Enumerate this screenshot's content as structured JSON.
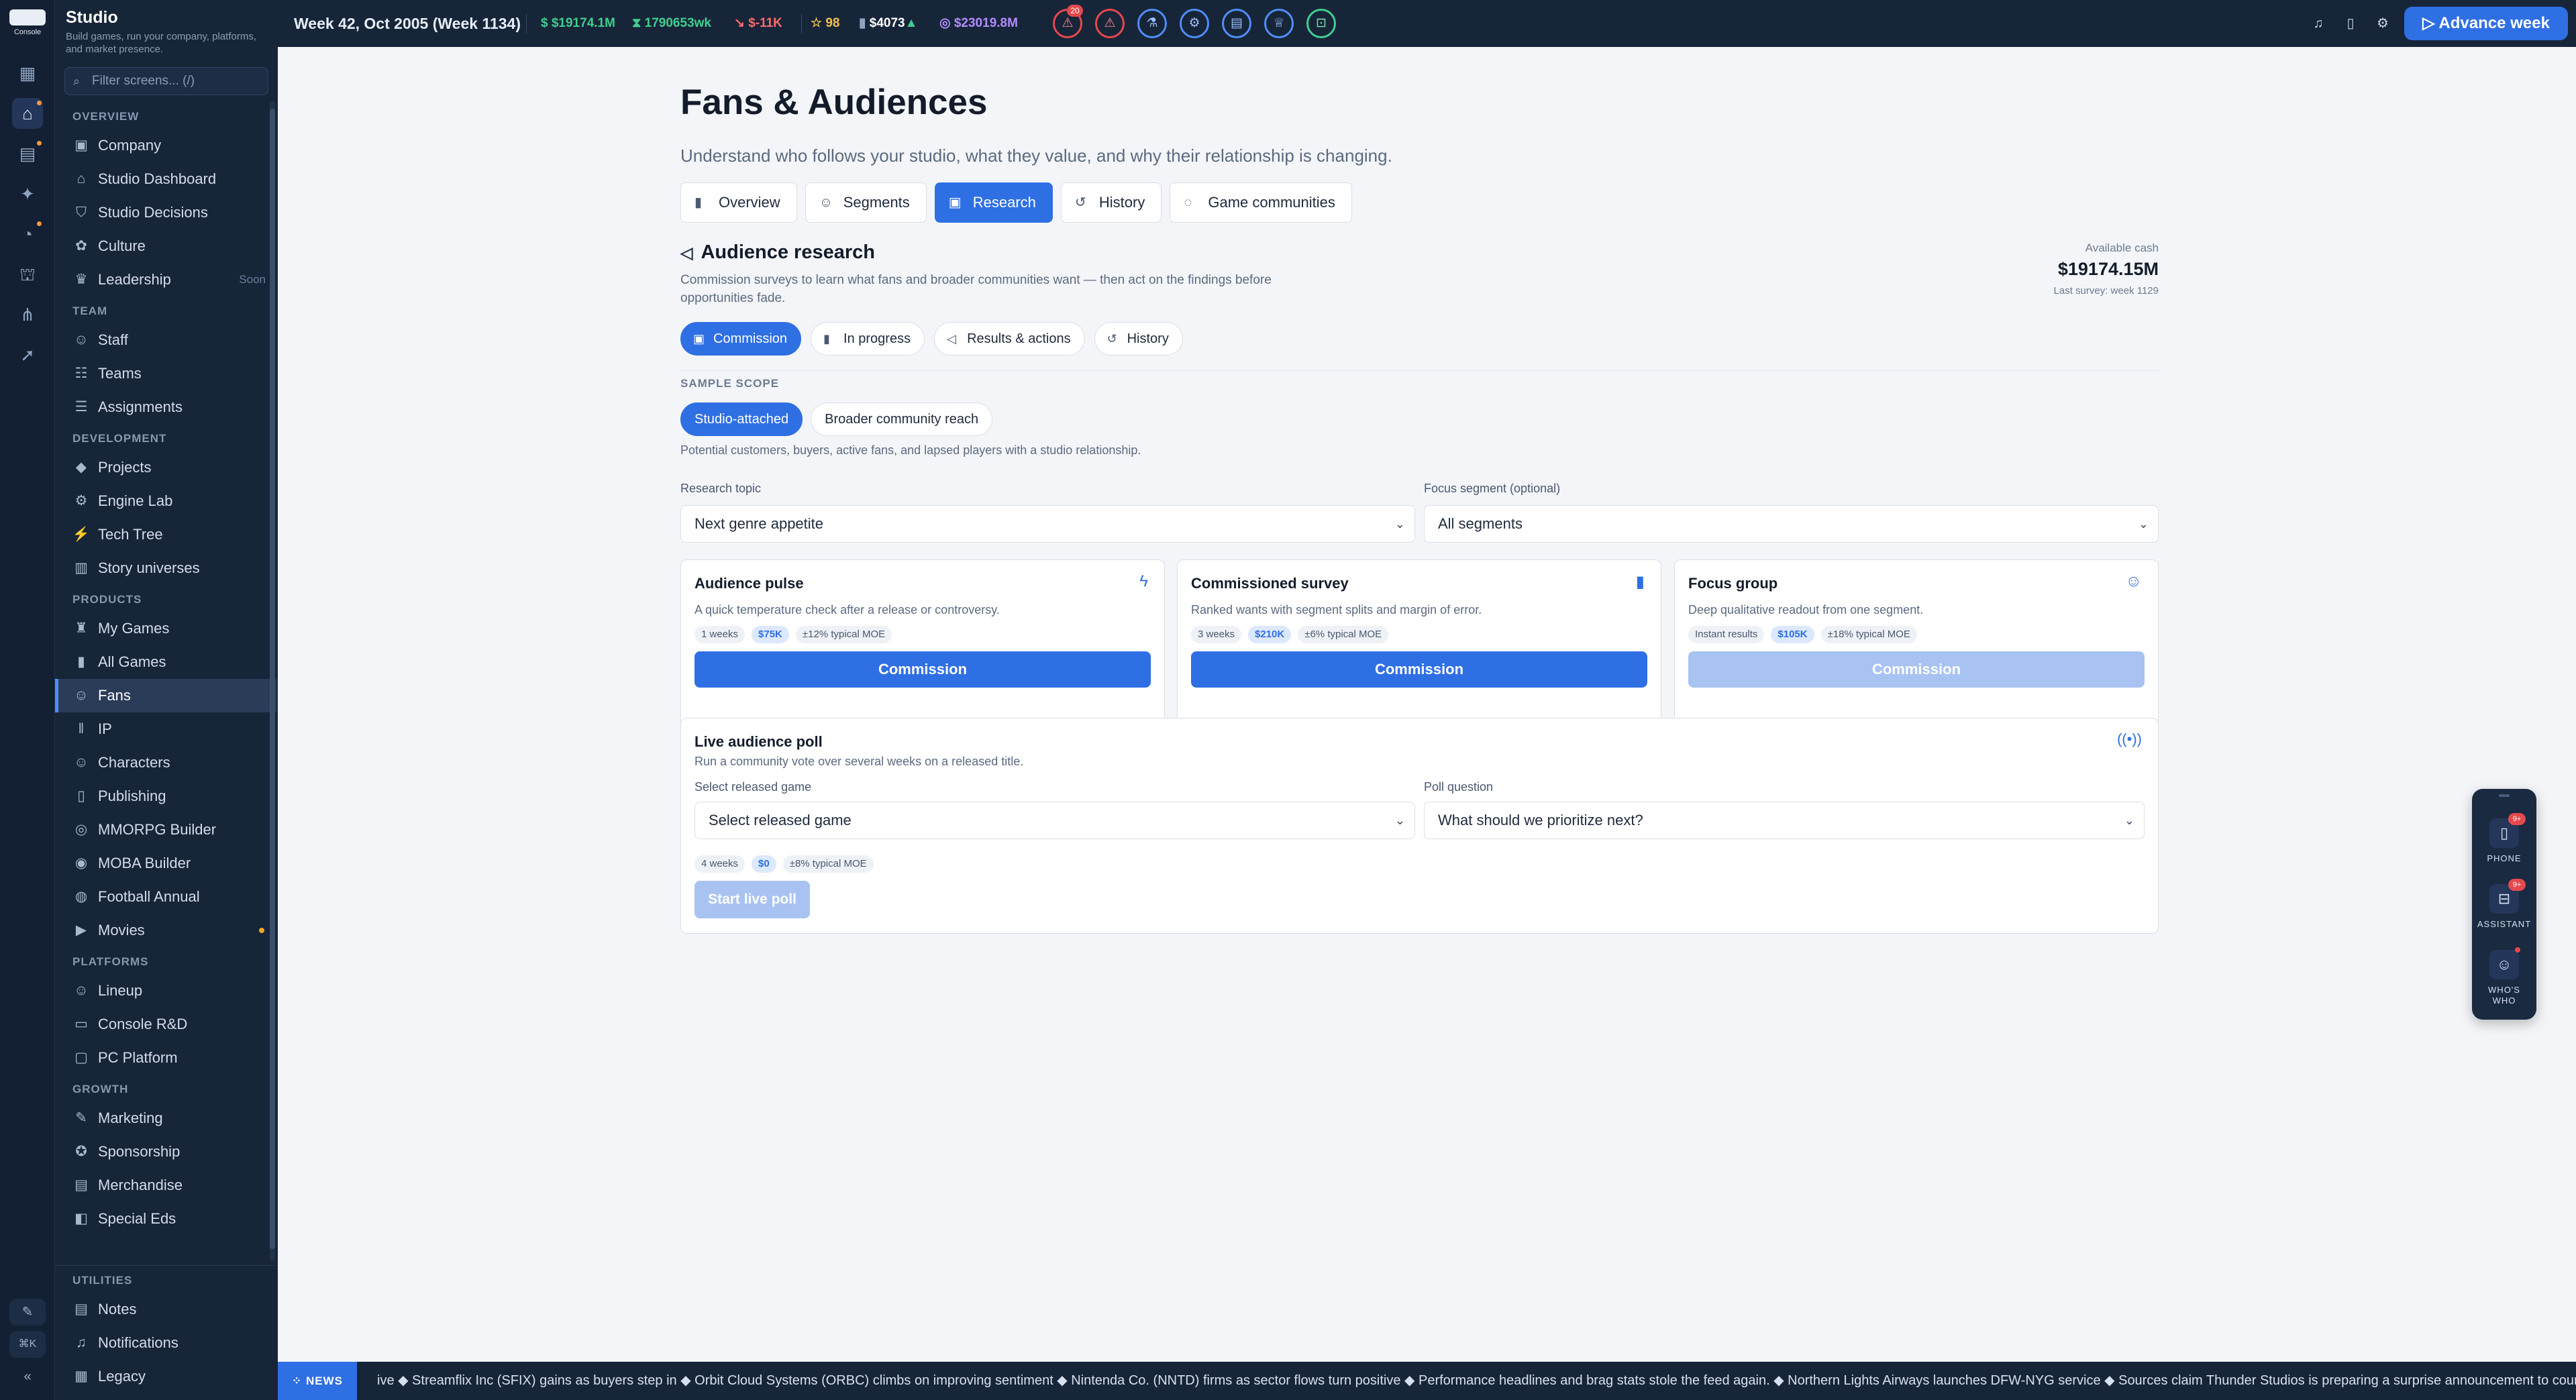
{
  "rail": {
    "logo_text": "Console",
    "items": [
      {
        "icon": "grid-icon",
        "glyph": "▦"
      },
      {
        "icon": "studio-icon",
        "glyph": "⌂"
      },
      {
        "icon": "news-icon",
        "glyph": "▤"
      },
      {
        "icon": "sparkle-icon",
        "glyph": "✦"
      },
      {
        "icon": "gauge-icon",
        "glyph": "◔"
      },
      {
        "icon": "bank-icon",
        "glyph": "⛫"
      },
      {
        "icon": "share-icon",
        "glyph": "⋔"
      },
      {
        "icon": "rocket-icon",
        "glyph": "➚"
      }
    ],
    "shortcut": "⌘K"
  },
  "sidebar": {
    "title": "Studio",
    "subtitle": "Build games, run your company, platforms, and market presence.",
    "filter_placeholder": "Filter screens... (/)",
    "sections": [
      {
        "label": "OVERVIEW",
        "items": [
          {
            "label": "Company",
            "glyph": "▣"
          },
          {
            "label": "Studio Dashboard",
            "glyph": "⌂"
          },
          {
            "label": "Studio Decisions",
            "glyph": "⛉"
          },
          {
            "label": "Culture",
            "glyph": "✿"
          },
          {
            "label": "Leadership",
            "glyph": "♛",
            "note": "Soon"
          }
        ]
      },
      {
        "label": "TEAM",
        "items": [
          {
            "label": "Staff",
            "glyph": "☺"
          },
          {
            "label": "Teams",
            "glyph": "☷"
          },
          {
            "label": "Assignments",
            "glyph": "☰"
          }
        ]
      },
      {
        "label": "DEVELOPMENT",
        "items": [
          {
            "label": "Projects",
            "glyph": "◆"
          },
          {
            "label": "Engine Lab",
            "glyph": "⚙"
          },
          {
            "label": "Tech Tree",
            "glyph": "⚡"
          },
          {
            "label": "Story universes",
            "glyph": "▥"
          }
        ]
      },
      {
        "label": "PRODUCTS",
        "items": [
          {
            "label": "My Games",
            "glyph": "♜"
          },
          {
            "label": "All Games",
            "glyph": "▮"
          },
          {
            "label": "Fans",
            "glyph": "☺",
            "active": true
          },
          {
            "label": "IP",
            "glyph": "‖"
          },
          {
            "label": "Characters",
            "glyph": "☺"
          },
          {
            "label": "Publishing",
            "glyph": "▯"
          },
          {
            "label": "MMORPG Builder",
            "glyph": "◎"
          },
          {
            "label": "MOBA Builder",
            "glyph": "◉"
          },
          {
            "label": "Football Annual",
            "glyph": "◍"
          },
          {
            "label": "Movies",
            "glyph": "▶",
            "dot": true
          }
        ]
      },
      {
        "label": "PLATFORMS",
        "items": [
          {
            "label": "Lineup",
            "glyph": "☺"
          },
          {
            "label": "Console R&D",
            "glyph": "▭"
          },
          {
            "label": "PC Platform",
            "glyph": "▢"
          }
        ]
      },
      {
        "label": "GROWTH",
        "items": [
          {
            "label": "Marketing",
            "glyph": "✎"
          },
          {
            "label": "Sponsorship",
            "glyph": "✪"
          },
          {
            "label": "Merchandise",
            "glyph": "▤"
          },
          {
            "label": "Special Eds",
            "glyph": "◧"
          }
        ]
      }
    ],
    "utilities": {
      "label": "UTILITIES",
      "items": [
        {
          "label": "Notes",
          "glyph": "▤"
        },
        {
          "label": "Notifications",
          "glyph": "♫"
        },
        {
          "label": "Legacy",
          "glyph": "▦"
        }
      ]
    }
  },
  "topbar": {
    "date": "Week 42, Oct 2005 (Week 1134)",
    "cash": "$19174.1M",
    "burn": "1790653wk",
    "change": "$-11K",
    "rating": "98",
    "stock": "$4073",
    "valuation": "$23019.8M",
    "alert_count": "20",
    "advance_label": "Advance week"
  },
  "page": {
    "title": "Fans & Audiences",
    "subtitle": "Understand who follows your studio, what they value, and why their relationship is changing.",
    "tabs": [
      {
        "label": "Overview",
        "glyph": "▮"
      },
      {
        "label": "Segments",
        "glyph": "☺"
      },
      {
        "label": "Research",
        "glyph": "▣",
        "active": true
      },
      {
        "label": "History",
        "glyph": "↺"
      },
      {
        "label": "Game communities",
        "glyph": "◌"
      }
    ]
  },
  "research": {
    "title": "Audience research",
    "description": "Commission surveys to learn what fans and broader communities want — then act on the findings before opportunities fade.",
    "cash_label": "Available cash",
    "cash_value": "$19174.15M",
    "last_survey": "Last survey: week 1129",
    "subtabs": [
      {
        "label": "Commission",
        "glyph": "▣",
        "active": true
      },
      {
        "label": "In progress",
        "glyph": "▮"
      },
      {
        "label": "Results & actions",
        "glyph": "◁"
      },
      {
        "label": "History",
        "glyph": "↺"
      }
    ],
    "sample_scope_label": "SAMPLE SCOPE",
    "scope_options": [
      {
        "label": "Studio-attached",
        "active": true
      },
      {
        "label": "Broader community reach"
      }
    ],
    "scope_description": "Potential customers, buyers, active fans, and lapsed players with a studio relationship.",
    "topic_label": "Research topic",
    "topic_value": "Next genre appetite",
    "segment_label": "Focus segment (optional)",
    "segment_value": "All segments",
    "cards": [
      {
        "title": "Audience pulse",
        "icon": "lightning-icon",
        "glyph": "ϟ",
        "desc": "A quick temperature check after a release or controversy.",
        "tags": [
          "1 weeks",
          "$75K",
          "±12% typical MOE"
        ],
        "button": "Commission",
        "enabled": true
      },
      {
        "title": "Commissioned survey",
        "icon": "bar-chart-icon",
        "glyph": "▮",
        "desc": "Ranked wants with segment splits and margin of error.",
        "tags": [
          "3 weeks",
          "$210K",
          "±6% typical MOE"
        ],
        "button": "Commission",
        "enabled": true
      },
      {
        "title": "Focus group",
        "icon": "users-icon",
        "glyph": "☺",
        "desc": "Deep qualitative readout from one segment.",
        "tags": [
          "Instant results",
          "$105K",
          "±18% typical MOE"
        ],
        "button": "Commission",
        "enabled": false
      }
    ],
    "poll": {
      "title": "Live audience poll",
      "desc": "Run a community vote over several weeks on a released title.",
      "game_label": "Select released game",
      "game_value": "Select released game",
      "question_label": "Poll question",
      "question_value": "What should we prioritize next?",
      "tags": [
        "4 weeks",
        "$0",
        "±8% typical MOE"
      ],
      "button": "Start live poll"
    }
  },
  "dock": {
    "items": [
      {
        "label": "PHONE",
        "badge": "9+"
      },
      {
        "label": "ASSISTANT",
        "badge": "9+"
      },
      {
        "label": "WHO'S WHO"
      }
    ]
  },
  "news": {
    "label": "NEWS",
    "text": "ive ◆ Streamflix Inc (SFIX) gains as buyers step in ◆ Orbit Cloud Systems (ORBC) climbs on improving sentiment ◆ Nintenda Co. (NNTD) firms as sector flows turn positive ◆ Performance headlines and brag stats stole the feed again. ◆ Northern Lights Airways launches DFW-NYG service ◆ Sources claim Thunder Studios is preparing a surprise announcement to counter Mega Co"
  },
  "colors": {
    "accent": "#2f6fe4",
    "nav_bg": "#172539",
    "positive": "#3fcf8e",
    "negative": "#ff6b6b",
    "gold": "#f5c04a",
    "purple": "#b18cff"
  }
}
